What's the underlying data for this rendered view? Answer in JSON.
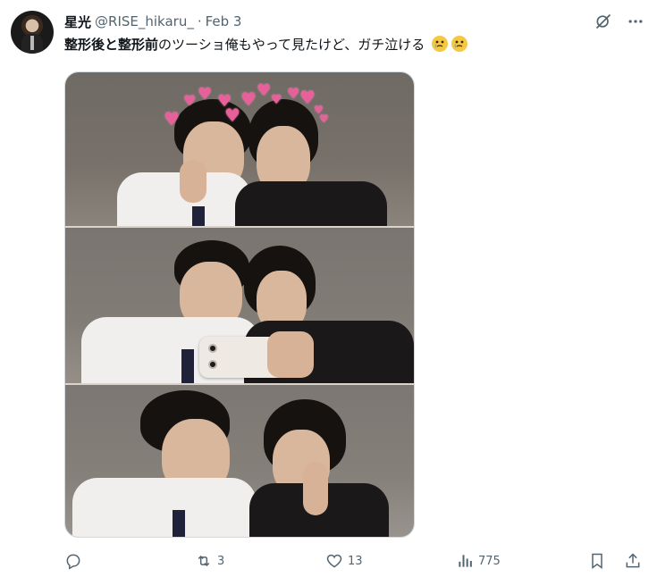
{
  "author": {
    "name": "星光",
    "handle": "@RISE_hikaru_",
    "separator": "·",
    "date": "Feb 3"
  },
  "tweet": {
    "bold_part_1": "整形後",
    "mid_part": "と",
    "bold_part_2": "整形前",
    "rest": "のツーショ俺もやって見たけど、ガチ泣ける",
    "emojis": [
      "face-holding-back-tears",
      "face-holding-back-tears"
    ]
  },
  "top_icons": [
    "grok-icon",
    "more-icon"
  ],
  "media": {
    "panels": 3,
    "hearts_color": "#e8609a"
  },
  "actions": {
    "reply_count": "",
    "retweet_count": "3",
    "like_count": "13",
    "views_count": "775"
  },
  "colors": {
    "text_primary": "#0f1419",
    "text_secondary": "#536471",
    "border": "#cfd9de"
  }
}
